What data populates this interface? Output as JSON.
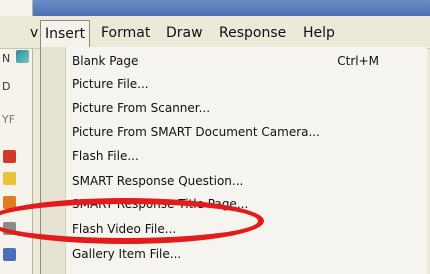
{
  "window": {
    "left_fragments": [
      "N",
      "D",
      "YF"
    ]
  },
  "menubar": {
    "items": [
      {
        "label": "v"
      },
      {
        "label": "Insert"
      },
      {
        "label": "Format"
      },
      {
        "label": "Draw"
      },
      {
        "label": "Response"
      },
      {
        "label": "Help"
      }
    ]
  },
  "insert_menu": {
    "items": [
      {
        "label": "Blank Page",
        "shortcut": "Ctrl+M"
      },
      {
        "label": "Picture File..."
      },
      {
        "label": "Picture From Scanner..."
      },
      {
        "label": "Picture From SMART Document Camera..."
      },
      {
        "label": "Flash File..."
      },
      {
        "label": "SMART Response Question..."
      },
      {
        "label": "SMART Response Title Page..."
      },
      {
        "label": "Flash Video File..."
      },
      {
        "label": "Gallery Item File..."
      }
    ]
  },
  "annotation": {
    "color": "#e41b1b",
    "highlights": "Flash Video File..."
  },
  "theme": {
    "menu_bg": "#ece9d8",
    "dropdown_bg": "#f6f4ee",
    "title_blue": "#4d6fb0"
  }
}
